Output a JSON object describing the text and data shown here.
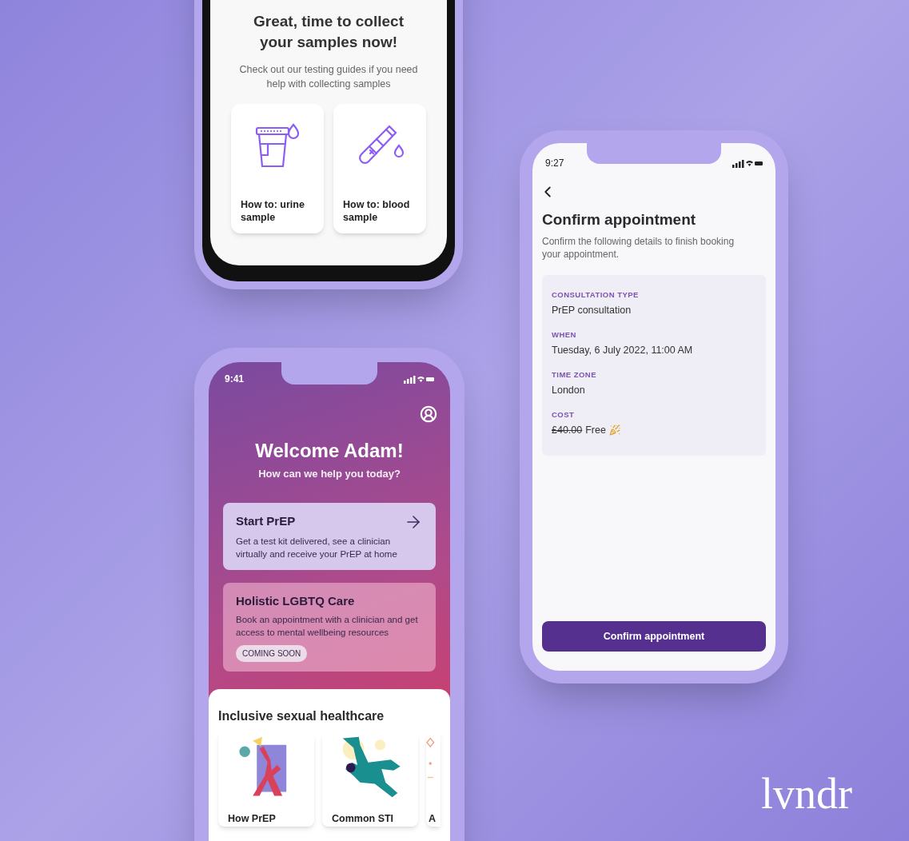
{
  "guides_screen": {
    "title": "Great, time to collect your samples now!",
    "subtitle": "Check out our testing guides if you need help with collecting samples",
    "guides": [
      {
        "kind": "urine",
        "label": "How to: urine sample"
      },
      {
        "kind": "blood",
        "label": "How to: blood sample"
      }
    ]
  },
  "home_screen": {
    "time": "9:41",
    "greeting": "Welcome Adam!",
    "prompt": "How can we help you today?",
    "services": [
      {
        "title": "Start PrEP",
        "description": "Get a test kit delivered, see a clinician virtually and receive your PrEP at home",
        "available": true
      },
      {
        "title": "Holistic LGBTQ Care",
        "description": "Book an appointment with a clinician and get access to mental wellbeing resources",
        "available": false,
        "badge": "COMING SOON"
      }
    ],
    "section_title": "Inclusive sexual healthcare",
    "articles": [
      {
        "kind": "figure-red",
        "label": "How PrEP"
      },
      {
        "kind": "figure-teal",
        "label": "Common STI"
      },
      {
        "kind": "partial",
        "label": "A"
      }
    ]
  },
  "confirm_screen": {
    "time": "9:27",
    "title": "Confirm appointment",
    "subtitle": "Confirm the following details to finish booking your appointment.",
    "details": [
      {
        "label": "CONSULTATION TYPE",
        "value": "PrEP consultation"
      },
      {
        "label": "WHEN",
        "value": "Tuesday, 6 July 2022, 11:00 AM"
      },
      {
        "label": "TIME ZONE",
        "value": "London"
      },
      {
        "label": "COST",
        "old_price": "£40.00",
        "value": "Free",
        "celebrate": true
      }
    ],
    "button": "Confirm appointment"
  },
  "brand_logo": "lvndr"
}
